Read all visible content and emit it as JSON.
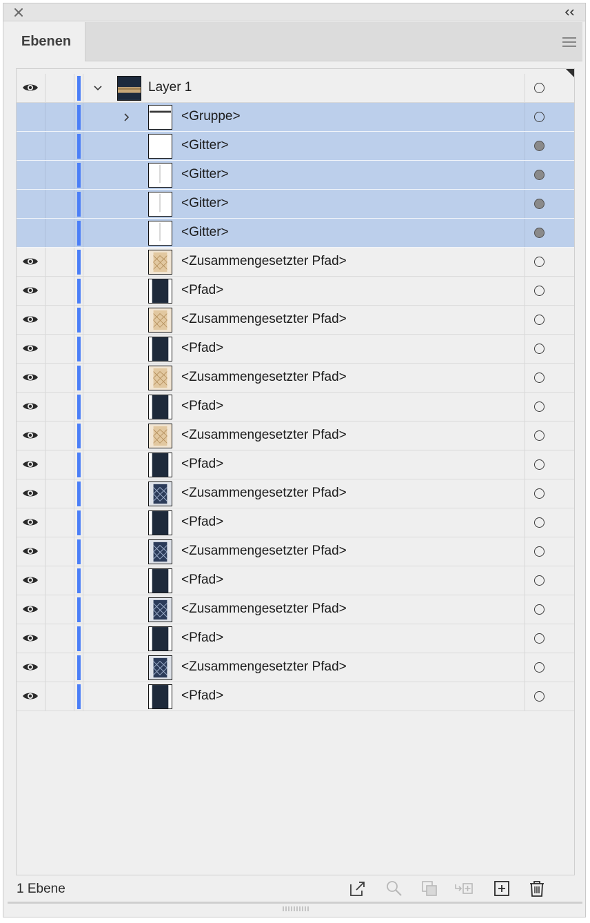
{
  "panel": {
    "tab_label": "Ebenen",
    "footer_status": "1 Ebene"
  },
  "icons": {
    "close": "close-icon",
    "collapse": "double-chevron-left-icon",
    "menu": "hamburger-menu-icon",
    "eye": "eye-icon",
    "expand_open": "chevron-down-icon",
    "expand_closed": "chevron-right-icon"
  },
  "colors": {
    "selection": "#bccfeb",
    "layer_color": "#4a7ef7",
    "panel_bg": "#efefef"
  },
  "layers": [
    {
      "name": "Layer 1",
      "kind": "layer",
      "visible": true,
      "expanded": true,
      "selected": false,
      "target_filled": false,
      "thumb": "layer"
    },
    {
      "name": "<Gruppe>",
      "kind": "group",
      "visible": false,
      "expanded": false,
      "selected": true,
      "target_filled": false,
      "thumb": "group"
    },
    {
      "name": "<Gitter>",
      "kind": "mesh",
      "visible": false,
      "selected": true,
      "target_filled": true,
      "thumb": "blank"
    },
    {
      "name": "<Gitter>",
      "kind": "mesh",
      "visible": false,
      "selected": true,
      "target_filled": true,
      "thumb": "line"
    },
    {
      "name": "<Gitter>",
      "kind": "mesh",
      "visible": false,
      "selected": true,
      "target_filled": true,
      "thumb": "line"
    },
    {
      "name": "<Gitter>",
      "kind": "mesh",
      "visible": false,
      "selected": true,
      "target_filled": true,
      "thumb": "line"
    },
    {
      "name": "<Zusammengesetzter Pfad>",
      "kind": "compound",
      "visible": true,
      "selected": false,
      "target_filled": false,
      "thumb": "gold"
    },
    {
      "name": "<Pfad>",
      "kind": "path",
      "visible": true,
      "selected": false,
      "target_filled": false,
      "thumb": "dark"
    },
    {
      "name": "<Zusammengesetzter Pfad>",
      "kind": "compound",
      "visible": true,
      "selected": false,
      "target_filled": false,
      "thumb": "gold"
    },
    {
      "name": "<Pfad>",
      "kind": "path",
      "visible": true,
      "selected": false,
      "target_filled": false,
      "thumb": "dark"
    },
    {
      "name": "<Zusammengesetzter Pfad>",
      "kind": "compound",
      "visible": true,
      "selected": false,
      "target_filled": false,
      "thumb": "gold"
    },
    {
      "name": "<Pfad>",
      "kind": "path",
      "visible": true,
      "selected": false,
      "target_filled": false,
      "thumb": "dark"
    },
    {
      "name": "<Zusammengesetzter Pfad>",
      "kind": "compound",
      "visible": true,
      "selected": false,
      "target_filled": false,
      "thumb": "gold"
    },
    {
      "name": "<Pfad>",
      "kind": "path",
      "visible": true,
      "selected": false,
      "target_filled": false,
      "thumb": "dark"
    },
    {
      "name": "<Zusammengesetzter Pfad>",
      "kind": "compound",
      "visible": true,
      "selected": false,
      "target_filled": false,
      "thumb": "navy"
    },
    {
      "name": "<Pfad>",
      "kind": "path",
      "visible": true,
      "selected": false,
      "target_filled": false,
      "thumb": "dark"
    },
    {
      "name": "<Zusammengesetzter Pfad>",
      "kind": "compound",
      "visible": true,
      "selected": false,
      "target_filled": false,
      "thumb": "navy"
    },
    {
      "name": "<Pfad>",
      "kind": "path",
      "visible": true,
      "selected": false,
      "target_filled": false,
      "thumb": "dark"
    },
    {
      "name": "<Zusammengesetzter Pfad>",
      "kind": "compound",
      "visible": true,
      "selected": false,
      "target_filled": false,
      "thumb": "navy"
    },
    {
      "name": "<Pfad>",
      "kind": "path",
      "visible": true,
      "selected": false,
      "target_filled": false,
      "thumb": "dark"
    },
    {
      "name": "<Zusammengesetzter Pfad>",
      "kind": "compound",
      "visible": true,
      "selected": false,
      "target_filled": false,
      "thumb": "navy"
    },
    {
      "name": "<Pfad>",
      "kind": "path",
      "visible": true,
      "selected": false,
      "target_filled": false,
      "thumb": "dark"
    }
  ],
  "footer_tools": [
    {
      "name": "export-icon",
      "enabled": true
    },
    {
      "name": "locate-object-icon",
      "enabled": false
    },
    {
      "name": "make-clipping-mask-icon",
      "enabled": false
    },
    {
      "name": "create-sublayer-icon",
      "enabled": false
    },
    {
      "name": "new-layer-icon",
      "enabled": true
    },
    {
      "name": "trash-icon",
      "enabled": true
    }
  ]
}
